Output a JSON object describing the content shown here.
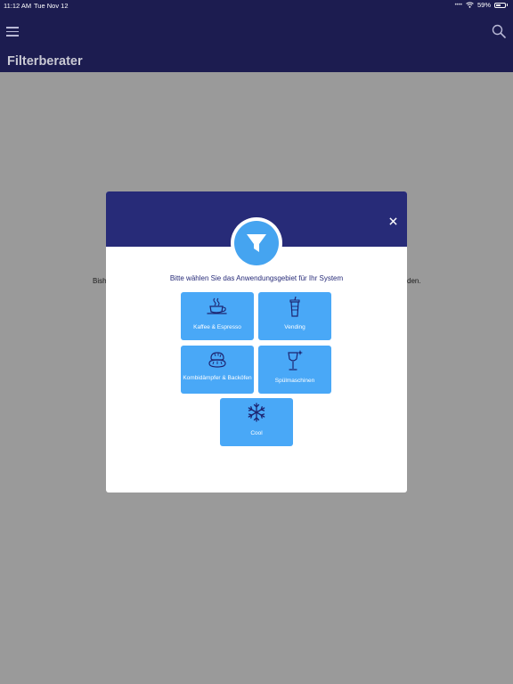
{
  "status": {
    "time": "11:12 AM",
    "date": "Tue Nov 12",
    "battery": "59%",
    "battery_level": 0.59
  },
  "header": {
    "title": "Filterberater"
  },
  "background": {
    "left_fragment": "Bish",
    "right_fragment": "den."
  },
  "modal": {
    "prompt": "Bitte wählen Sie das Anwendungsgebiet für Ihr System",
    "tiles": [
      {
        "label": "Kaffee & Espresso",
        "icon": "coffee-cup-icon"
      },
      {
        "label": "Vending",
        "icon": "drink-cup-icon"
      },
      {
        "label": "Kombidämpfer & Backöfen",
        "icon": "bread-icon"
      },
      {
        "label": "Spülmaschinen",
        "icon": "sparkling-glass-icon"
      },
      {
        "label": "Cool",
        "icon": "snowflake-icon"
      }
    ]
  },
  "colors": {
    "navbar": "#1c1c50",
    "modal_header": "#272b78",
    "tile": "#49a8f7",
    "badge": "#45a4f0",
    "backdrop": "#9a9a9a"
  }
}
